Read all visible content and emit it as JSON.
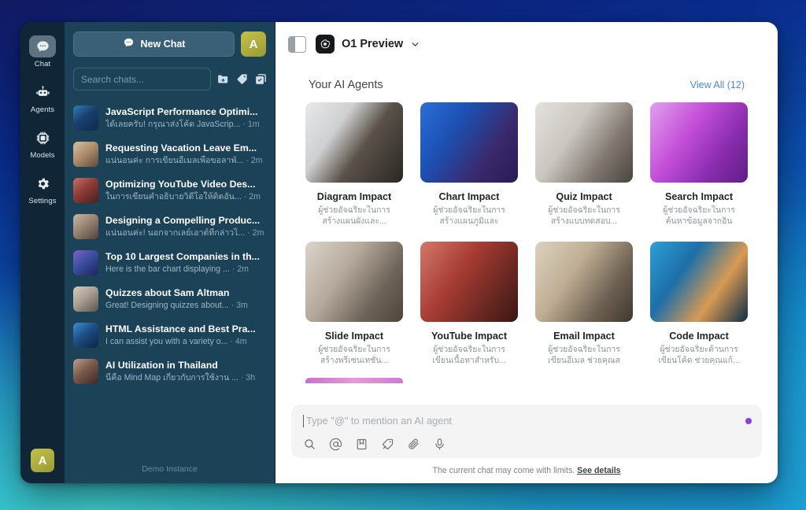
{
  "rail": {
    "items": [
      {
        "label": "Chat",
        "icon": "chat-bubble-icon",
        "active": true
      },
      {
        "label": "Agents",
        "icon": "robot-icon",
        "active": false
      },
      {
        "label": "Models",
        "icon": "chip-icon",
        "active": false
      },
      {
        "label": "Settings",
        "icon": "gear-icon",
        "active": false
      }
    ],
    "avatar_initial": "A"
  },
  "sidebar": {
    "new_chat_label": "New Chat",
    "account_initial": "A",
    "search_placeholder": "Search chats...",
    "action_icons": [
      "new-folder-icon",
      "tag-icon",
      "select-multiple-icon"
    ],
    "demo_instance": "Demo Instance",
    "chats": [
      {
        "title": "JavaScript Performance Optimi...",
        "preview": "ได้เลยครับ! กรุณาส่งโค้ด JavaScrip...",
        "time": "1m",
        "c1": "#1a3f6e",
        "c2": "#0d2a52",
        "c3": "#2f7fb8"
      },
      {
        "title": "Requesting Vacation Leave Em...",
        "preview": "แน่นอนค่ะ การเขียนอีเมลเพื่อขอลาพั...",
        "time": "2m",
        "c1": "#b08f6e",
        "c2": "#5e4a3c",
        "c3": "#d7c0a3"
      },
      {
        "title": "Optimizing YouTube Video Des...",
        "preview": "ในการเขียนคำอธิบายวิดีโอให้ติดอัน...",
        "time": "2m",
        "c1": "#8e3a36",
        "c2": "#4a1f1e",
        "c3": "#c4736a"
      },
      {
        "title": "Designing a Compelling Produc...",
        "preview": "แน่นอนค่ะ! นอกจากเลย์เอาต์ที่กล่าวไ...",
        "time": "2m",
        "c1": "#9a8574",
        "c2": "#4f4239",
        "c3": "#c9b9a7"
      },
      {
        "title": "Top 10 Largest Companies in th...",
        "preview": "Here is the bar chart displaying ...",
        "time": "2m",
        "c1": "#3b4fa0",
        "c2": "#1b2456",
        "c3": "#7a63c9"
      },
      {
        "title": "Quizzes about Sam Altman",
        "preview": "Great! Designing quizzes about...",
        "time": "3m",
        "c1": "#a99f92",
        "c2": "#5c554c",
        "c3": "#d4ccc1"
      },
      {
        "title": "HTML Assistance and Best Pra...",
        "preview": "I can assist you with a variety o...",
        "time": "4m",
        "c1": "#1d4f86",
        "c2": "#0b2342",
        "c3": "#3b8fd0"
      },
      {
        "title": "AI Utilization in Thailand",
        "preview": "นี่คือ Mind Map เกี่ยวกับการใช้งาน ...",
        "time": "3h",
        "c1": "#7c5a4c",
        "c2": "#3a2722",
        "c3": "#bda08e"
      }
    ]
  },
  "header": {
    "sidebar_toggle_icon": "panel-toggle-icon",
    "model_logo_icon": "openai-logo-icon",
    "model_name": "O1 Preview",
    "chevron_icon": "chevron-down-icon"
  },
  "agents_section": {
    "title": "Your AI Agents",
    "view_all_label": "View All (12)",
    "cards": [
      {
        "name": "Diagram Impact",
        "desc": "ผู้ช่วยอัจฉริยะในการ สร้างแผนผังและ...",
        "c1": "#e8e9ea",
        "c2": "#2a2724",
        "c3": "#9b8e84"
      },
      {
        "name": "Chart Impact",
        "desc": "ผู้ช่วยอัจฉริยะในการ สร้างแผนภูมิและกราฟ..",
        "c1": "#1c4fb0",
        "c2": "#2a1a54",
        "c3": "#6a7fd8"
      },
      {
        "name": "Quiz Impact",
        "desc": "ผู้ช่วยอัจฉริยะในการ สร้างแบบทดสอบ...",
        "c1": "#d8d4d0",
        "c2": "#4a443e",
        "c3": "#a59c93"
      },
      {
        "name": "Search Impact",
        "desc": "ผู้ช่วยอัจฉริยะในการ ค้นหาข้อมูลจากอินเทอ...",
        "c1": "#c44fd8",
        "c2": "#5e1f86",
        "c3": "#e2a0ef"
      },
      {
        "name": "Slide Impact",
        "desc": "ผู้ช่วยอัจฉริยะในการ สร้างพรีเซนเทชั่น...",
        "c1": "#cfc6bb",
        "c2": "#4e4439",
        "c3": "#9d9288"
      },
      {
        "name": "YouTube Impact",
        "desc": "ผู้ช่วยอัจฉริยะในการ เขียนเนื้อหาสำหรับ...",
        "c1": "#a63b33",
        "c2": "#4d1c18",
        "c3": "#d4786c"
      },
      {
        "name": "Email Impact",
        "desc": "ผู้ช่วยอัจฉริยะในการ เขียนอีเมล ช่วยคุณสร้า...",
        "c1": "#cbbfae",
        "c2": "#4a4036",
        "c3": "#a08c74"
      },
      {
        "name": "Code Impact",
        "desc": "ผู้ช่วยอัจฉริยะด้านการ เขียนโค้ด ช่วยคุณแก้...",
        "c1": "#1d7fb8",
        "c2": "#0d2c48",
        "c3": "#d89a52"
      }
    ]
  },
  "composer": {
    "placeholder": "Type \"@\" to mention an AI agent",
    "tools": [
      "search-icon",
      "at-sign-icon",
      "bookmark-icon",
      "tag-pen-icon",
      "paperclip-icon",
      "microphone-icon"
    ],
    "status_dot_color": "#8b3fe0"
  },
  "footer": {
    "note": "The current chat may come with limits.",
    "link_label": "See details"
  }
}
